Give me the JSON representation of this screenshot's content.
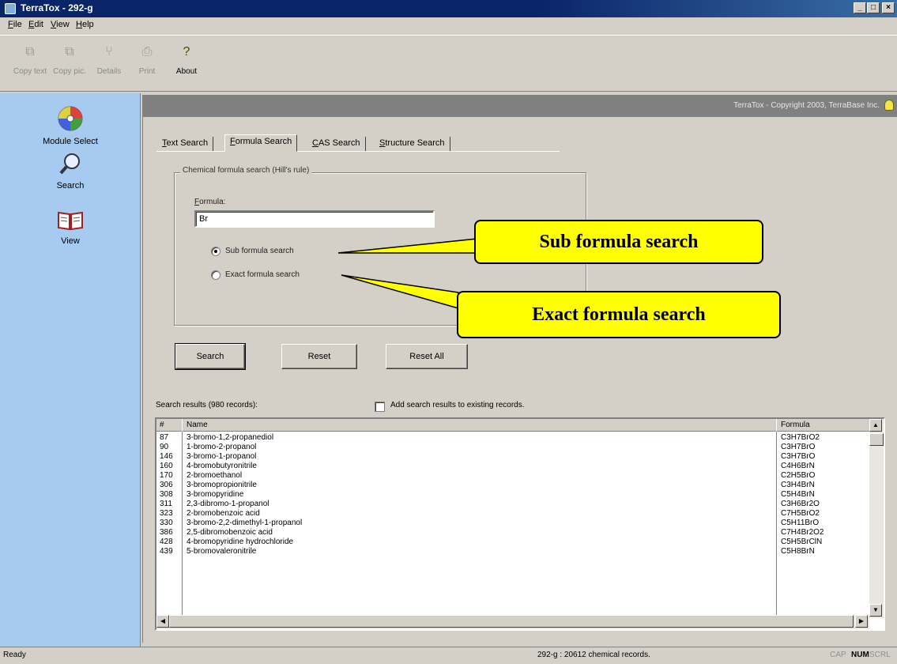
{
  "window": {
    "title": "TerraTox - 292-g",
    "controls": [
      "_",
      "□",
      "×"
    ]
  },
  "menu": [
    "File",
    "Edit",
    "View",
    "Help"
  ],
  "toolbar": [
    {
      "label": "Copy text",
      "icon": "copy-text-icon",
      "enabled": false
    },
    {
      "label": "Copy pic.",
      "icon": "copy-picture-icon",
      "enabled": false
    },
    {
      "label": "Details",
      "icon": "details-icon",
      "enabled": false
    },
    {
      "label": "Print",
      "icon": "print-icon",
      "enabled": false
    },
    {
      "label": "About",
      "icon": "about-icon",
      "enabled": true
    }
  ],
  "sidebar": [
    {
      "label": "Module Select",
      "icon": "cd-disc-icon"
    },
    {
      "label": "Search",
      "icon": "magnifier-icon"
    },
    {
      "label": "View",
      "icon": "open-book-icon"
    }
  ],
  "header": {
    "copyright": "TerraTox - Copyright 2003, TerraBase Inc."
  },
  "tabs": [
    {
      "label": "Text Search",
      "active": false
    },
    {
      "label": "Formula Search",
      "active": true
    },
    {
      "label": "CAS Search",
      "active": false
    },
    {
      "label": "Structure Search",
      "active": false
    }
  ],
  "formula_panel": {
    "group_title": "Chemical formula search (Hill's rule)",
    "formula_label": "Formula:",
    "formula_value": "Br",
    "radio_sub": "Sub formula search",
    "radio_exact": "Exact formula search",
    "selected": "sub"
  },
  "buttons": {
    "search": "Search",
    "reset": "Reset",
    "reset_all": "Reset All"
  },
  "callouts": {
    "sub": "Sub formula search",
    "exact": "Exact formula search"
  },
  "results": {
    "summary": "Search results (980 records):",
    "add_checkbox_label": "Add search results to existing records.",
    "add_checked": false,
    "columns": [
      "#",
      "Name",
      "Formula"
    ],
    "rows": [
      [
        "87",
        "3-bromo-1,2-propanediol",
        "C3H7BrO2"
      ],
      [
        "90",
        "1-bromo-2-propanol",
        "C3H7BrO"
      ],
      [
        "146",
        "3-bromo-1-propanol",
        "C3H7BrO"
      ],
      [
        "160",
        "4-bromobutyronitrile",
        "C4H6BrN"
      ],
      [
        "170",
        "2-bromoethanol",
        "C2H5BrO"
      ],
      [
        "306",
        "3-bromopropionitrile",
        "C3H4BrN"
      ],
      [
        "308",
        "3-bromopyridine",
        "C5H4BrN"
      ],
      [
        "311",
        "2,3-dibromo-1-propanol",
        "C3H6Br2O"
      ],
      [
        "323",
        "2-bromobenzoic acid",
        "C7H5BrO2"
      ],
      [
        "330",
        "3-bromo-2,2-dimethyl-1-propanol",
        "C5H11BrO"
      ],
      [
        "386",
        "2,5-dibromobenzoic acid",
        "C7H4Br2O2"
      ],
      [
        "428",
        "4-bromopyridine hydrochloride",
        "C5H5BrClN"
      ],
      [
        "439",
        "5-bromovaleronitrile",
        "C5H8BrN"
      ]
    ]
  },
  "status": {
    "left": "Ready",
    "center": "292-g : 20612 chemical records.",
    "indicators": [
      "CAP",
      "NUM",
      "SCRL"
    ],
    "active_indicator": "NUM"
  }
}
